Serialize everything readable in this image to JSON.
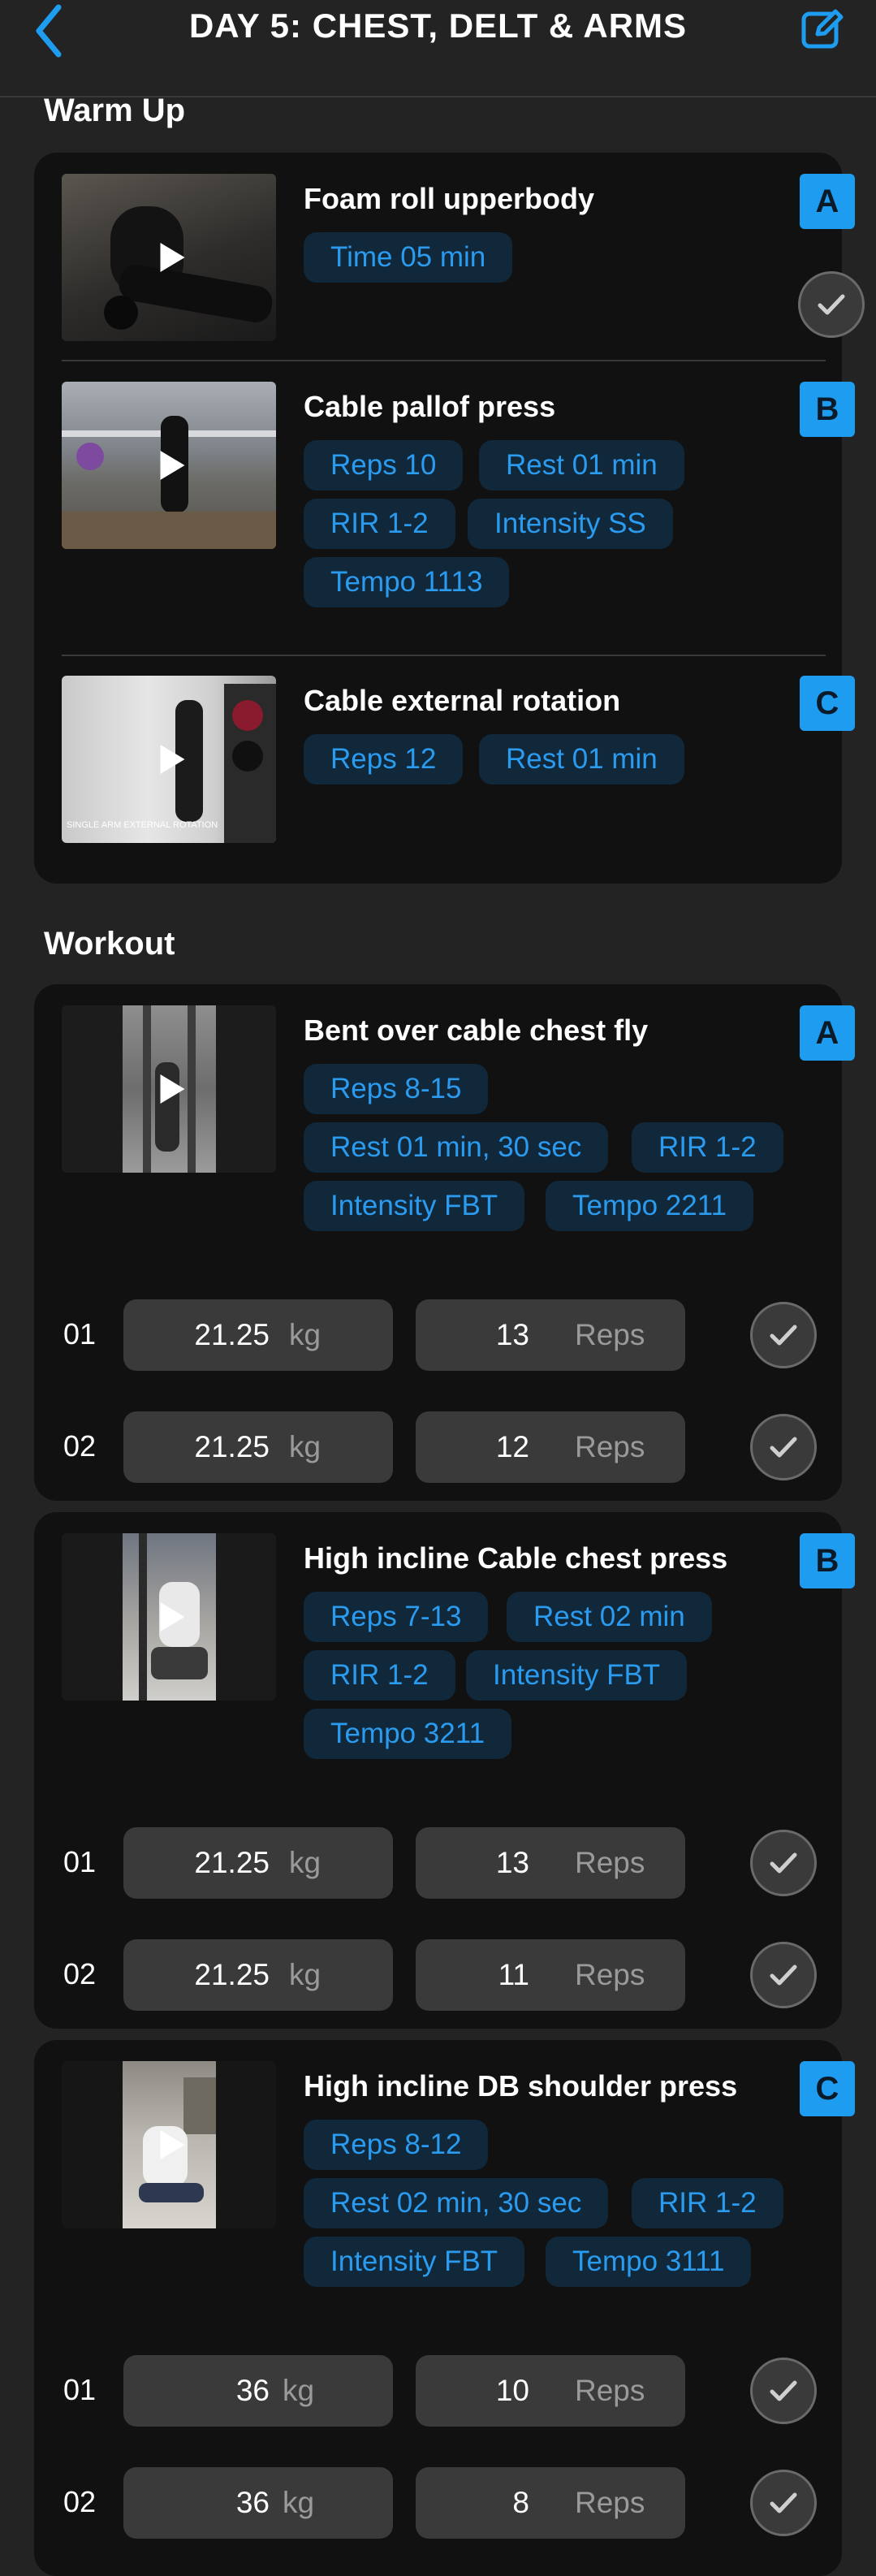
{
  "header": {
    "title": "DAY 5: CHEST, DELT & ARMS"
  },
  "colors": {
    "accent": "#1e9cf0",
    "tag_bg": "#10283a",
    "tag_text": "#2b9bf0"
  },
  "icons": {
    "back": "chevron-left-icon",
    "edit": "edit-icon",
    "play": "play-icon",
    "check": "check-icon"
  },
  "sections": {
    "warmup": {
      "title": "Warm Up",
      "exercises": [
        {
          "name": "Foam roll upperbody",
          "letter": "A",
          "tags": [
            "Time 05 min"
          ]
        },
        {
          "name": "Cable pallof press",
          "letter": "B",
          "tags": [
            "Reps 10",
            "Rest 01 min",
            "RIR 1-2",
            "Intensity SS",
            "Tempo 1113"
          ]
        },
        {
          "name": "Cable external rotation",
          "letter": "C",
          "tags": [
            "Reps 12",
            "Rest 01 min"
          ],
          "thumb_caption": "SINGLE ARM EXTERNAL ROTATION"
        }
      ]
    },
    "workout": {
      "title": "Workout",
      "exercises": [
        {
          "name": "Bent over cable chest fly",
          "letter": "A",
          "tags": [
            "Reps 8-15",
            "Rest 01 min, 30 sec",
            "RIR 1-2",
            "Intensity FBT",
            "Tempo 2211"
          ],
          "sets": [
            {
              "num": "01",
              "weight": "21.25",
              "weight_unit": "kg",
              "reps": "13",
              "reps_unit": "Reps"
            },
            {
              "num": "02",
              "weight": "21.25",
              "weight_unit": "kg",
              "reps": "12",
              "reps_unit": "Reps"
            }
          ]
        },
        {
          "name": "High incline Cable chest press",
          "letter": "B",
          "tags": [
            "Reps 7-13",
            "Rest 02 min",
            "RIR 1-2",
            "Intensity FBT",
            "Tempo 3211"
          ],
          "sets": [
            {
              "num": "01",
              "weight": "21.25",
              "weight_unit": "kg",
              "reps": "13",
              "reps_unit": "Reps"
            },
            {
              "num": "02",
              "weight": "21.25",
              "weight_unit": "kg",
              "reps": "11",
              "reps_unit": "Reps"
            }
          ]
        },
        {
          "name": "High incline DB shoulder press",
          "letter": "C",
          "tags": [
            "Reps 8-12",
            "Rest 02 min, 30 sec",
            "RIR 1-2",
            "Intensity FBT",
            "Tempo 3111"
          ],
          "sets": [
            {
              "num": "01",
              "weight": "36",
              "weight_unit": "kg",
              "reps": "10",
              "reps_unit": "Reps"
            },
            {
              "num": "02",
              "weight": "36",
              "weight_unit": "kg",
              "reps": "8",
              "reps_unit": "Reps"
            }
          ]
        }
      ]
    }
  }
}
